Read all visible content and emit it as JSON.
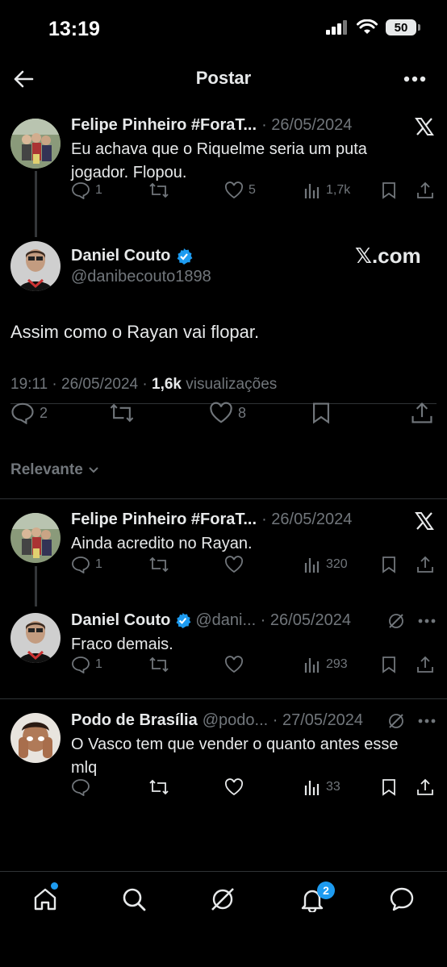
{
  "status": {
    "time": "13:19",
    "battery": "50"
  },
  "header": {
    "title": "Postar"
  },
  "parent": {
    "name": "Felipe Pinheiro #ForaT...",
    "meta": "· 26/05/2024",
    "text_l1": "Eu achava que o Riquelme seria um puta",
    "text_l2": "jogador. Flopou.",
    "replies": "1",
    "likes": "5",
    "views": "1,7k"
  },
  "main": {
    "name": "Daniel Couto",
    "handle": "@danibecouto1898",
    "watermark": "𝕏.com",
    "text": "Assim como o Rayan vai flopar.",
    "time": "19:11 · 26/05/2024 · ",
    "views_count": "1,6k",
    "views_label": " visualizações",
    "replies": "2",
    "likes": "8"
  },
  "sort": {
    "label": "Relevante"
  },
  "replies": [
    {
      "name": "Felipe Pinheiro #ForaT...",
      "meta": "· 26/05/2024",
      "text": "Ainda acredito no Rayan.",
      "replies": "1",
      "views": "320"
    },
    {
      "name": "Daniel Couto",
      "meta": "@dani... · 26/05/2024",
      "text": "Fraco demais.",
      "replies": "1",
      "views": "293"
    },
    {
      "name": "Podo de Brasília",
      "meta": "@podo... · 27/05/2024",
      "text_l1": "O Vasco tem que vender o quanto antes esse",
      "text_l2": "mlq",
      "views": "33"
    }
  ],
  "nav": {
    "notifications_badge": "2"
  },
  "colors": {
    "accent": "#1d9bf0",
    "background": "#000000",
    "muted": "#71767b"
  }
}
